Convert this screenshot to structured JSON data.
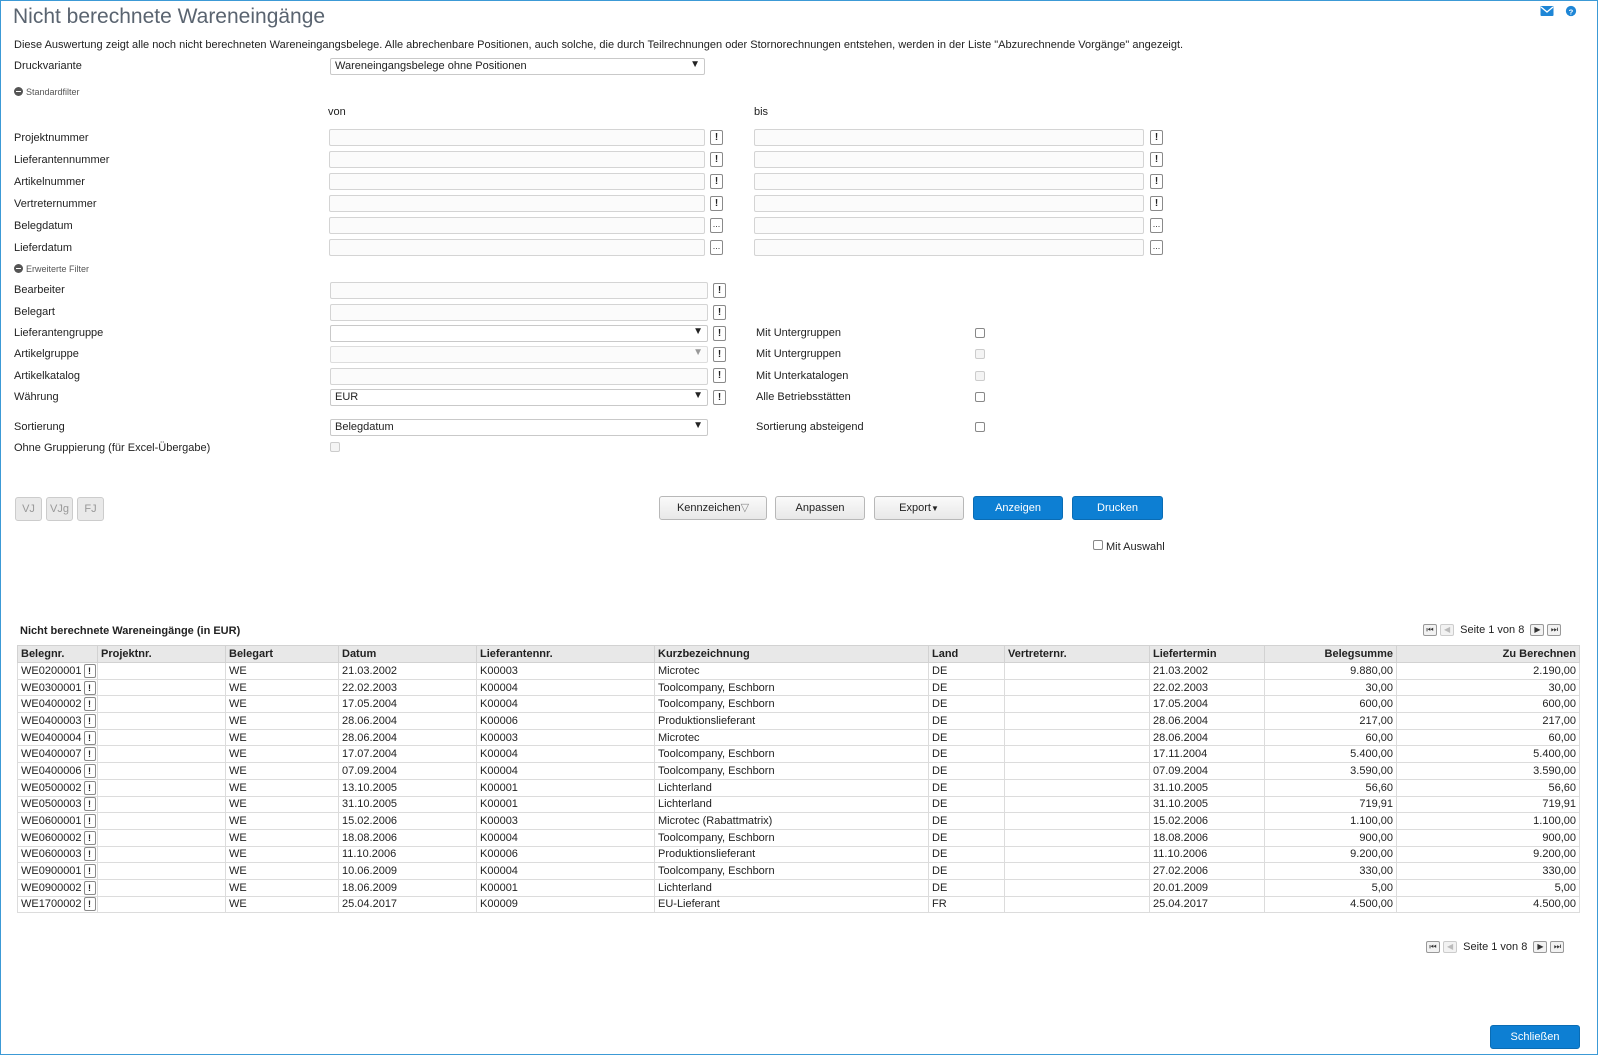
{
  "page": {
    "title": "Nicht berechnete Wareneingänge",
    "description": "Diese Auswertung zeigt alle noch nicht berechneten Wareneingangsbelege. Alle abrechenbare Positionen, auch solche, die durch Teilrechnungen oder Stornorechnungen entstehen, werden in der Liste \"Abzurechnende Vorgänge\" angezeigt.",
    "mail_icon": "mail-icon",
    "help_icon": "help-icon"
  },
  "druckvariante": {
    "label": "Druckvariante",
    "value": "Wareneingangsbelege ohne Positionen"
  },
  "standardfilter": {
    "heading": "Standardfilter",
    "von": "von",
    "bis": "bis",
    "rows": [
      {
        "label": "Projektnummer",
        "button": "!"
      },
      {
        "label": "Lieferantennummer",
        "button": "!"
      },
      {
        "label": "Artikelnummer",
        "button": "!"
      },
      {
        "label": "Vertreternummer",
        "button": "!"
      },
      {
        "label": "Belegdatum",
        "button": "..."
      },
      {
        "label": "Lieferdatum",
        "button": "..."
      }
    ]
  },
  "erweitertefilter": {
    "heading": "Erweiterte Filter",
    "bearbeiter": "Bearbeiter",
    "belegart": "Belegart",
    "lieferantengruppe": "Lieferantengruppe",
    "artikelgruppe": "Artikelgruppe",
    "artikelkatalog": "Artikelkatalog",
    "waehrung": "Währung",
    "waehrung_value": "EUR",
    "mit_untergruppen_1": "Mit Untergruppen",
    "mit_untergruppen_2": "Mit Untergruppen",
    "mit_unterkatalogen": "Mit Unterkatalogen",
    "alle_betriebsstaetten": "Alle Betriebsstätten",
    "sortierung": "Sortierung",
    "sortierung_value": "Belegdatum",
    "sortierung_absteigend": "Sortierung absteigend",
    "ohne_gruppierung": "Ohne Gruppierung (für Excel-Übergabe)"
  },
  "actions": {
    "vj": "VJ",
    "vjg": "VJg",
    "fj": "FJ",
    "kennzeichen": "Kennzeichen",
    "anpassen": "Anpassen",
    "export": "Export",
    "anzeigen": "Anzeigen",
    "drucken": "Drucken",
    "mit_auswahl": "Mit Auswahl"
  },
  "results": {
    "title": "Nicht berechnete Wareneingänge (in EUR)",
    "pager": "Seite 1 von 8",
    "columns": [
      "Belegnr.",
      "Projektnr.",
      "Belegart",
      "Datum",
      "Lieferantennr.",
      "Kurzbezeichnung",
      "Land",
      "Vertreternr.",
      "Liefertermin",
      "Belegsumme",
      "Zu Berechnen"
    ],
    "rows": [
      [
        "WE0200001",
        "",
        "WE",
        "21.03.2002",
        "K00003",
        "Microtec",
        "DE",
        "",
        "21.03.2002",
        "9.880,00",
        "2.190,00"
      ],
      [
        "WE0300001",
        "",
        "WE",
        "22.02.2003",
        "K00004",
        "Toolcompany, Eschborn",
        "DE",
        "",
        "22.02.2003",
        "30,00",
        "30,00"
      ],
      [
        "WE0400002",
        "",
        "WE",
        "17.05.2004",
        "K00004",
        "Toolcompany, Eschborn",
        "DE",
        "",
        "17.05.2004",
        "600,00",
        "600,00"
      ],
      [
        "WE0400003",
        "",
        "WE",
        "28.06.2004",
        "K00006",
        "Produktionslieferant",
        "DE",
        "",
        "28.06.2004",
        "217,00",
        "217,00"
      ],
      [
        "WE0400004",
        "",
        "WE",
        "28.06.2004",
        "K00003",
        "Microtec",
        "DE",
        "",
        "28.06.2004",
        "60,00",
        "60,00"
      ],
      [
        "WE0400007",
        "",
        "WE",
        "17.07.2004",
        "K00004",
        "Toolcompany, Eschborn",
        "DE",
        "",
        "17.11.2004",
        "5.400,00",
        "5.400,00"
      ],
      [
        "WE0400006",
        "",
        "WE",
        "07.09.2004",
        "K00004",
        "Toolcompany, Eschborn",
        "DE",
        "",
        "07.09.2004",
        "3.590,00",
        "3.590,00"
      ],
      [
        "WE0500002",
        "",
        "WE",
        "13.10.2005",
        "K00001",
        "Lichterland",
        "DE",
        "",
        "31.10.2005",
        "56,60",
        "56,60"
      ],
      [
        "WE0500003",
        "",
        "WE",
        "31.10.2005",
        "K00001",
        "Lichterland",
        "DE",
        "",
        "31.10.2005",
        "719,91",
        "719,91"
      ],
      [
        "WE0600001",
        "",
        "WE",
        "15.02.2006",
        "K00003",
        "Microtec (Rabattmatrix)",
        "DE",
        "",
        "15.02.2006",
        "1.100,00",
        "1.100,00"
      ],
      [
        "WE0600002",
        "",
        "WE",
        "18.08.2006",
        "K00004",
        "Toolcompany, Eschborn",
        "DE",
        "",
        "18.08.2006",
        "900,00",
        "900,00"
      ],
      [
        "WE0600003",
        "",
        "WE",
        "11.10.2006",
        "K00006",
        "Produktionslieferant",
        "DE",
        "",
        "11.10.2006",
        "9.200,00",
        "9.200,00"
      ],
      [
        "WE0900001",
        "",
        "WE",
        "10.06.2009",
        "K00004",
        "Toolcompany, Eschborn",
        "DE",
        "",
        "27.02.2006",
        "330,00",
        "330,00"
      ],
      [
        "WE0900002",
        "",
        "WE",
        "18.06.2009",
        "K00001",
        "Lichterland",
        "DE",
        "",
        "20.01.2009",
        "5,00",
        "5,00"
      ],
      [
        "WE1700002",
        "",
        "WE",
        "25.04.2017",
        "K00009",
        "EU-Lieferant",
        "FR",
        "",
        "25.04.2017",
        "4.500,00",
        "4.500,00"
      ]
    ]
  },
  "footer": {
    "schliessen": "Schließen"
  }
}
